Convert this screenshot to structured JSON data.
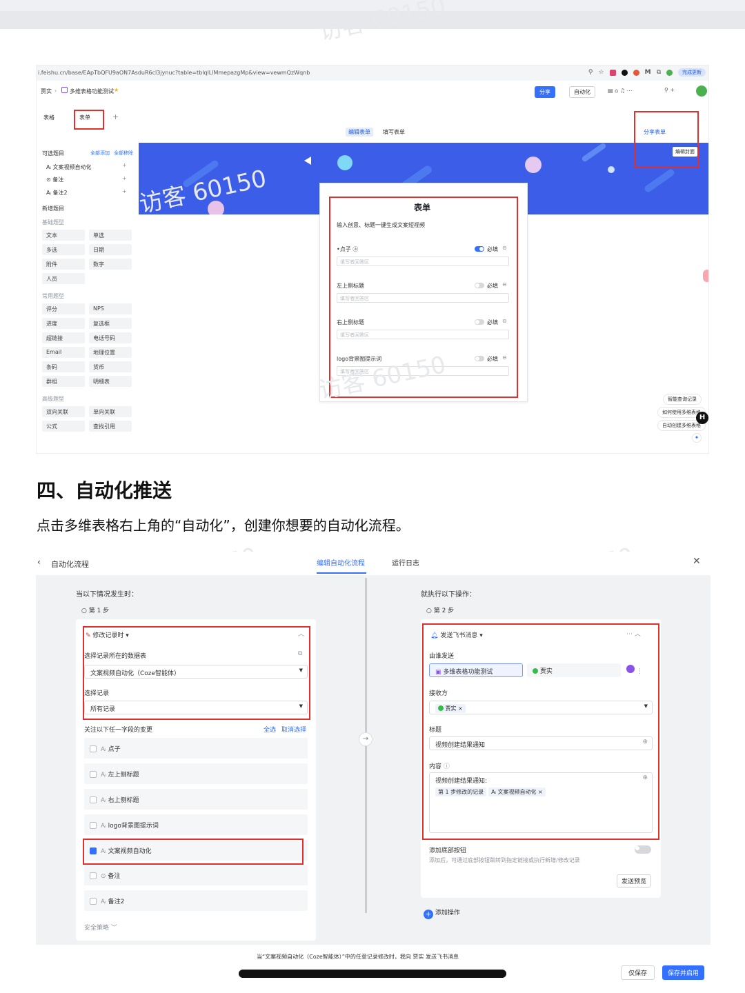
{
  "screenshot1": {
    "url": "i.feishu.cn/base/EApTbQFU9aON7AsduR6cl3jynuc?table=tblqlLlMmepazgMp&view=vewmQzWqnb",
    "update_button": "完成更新",
    "breadcrumb": [
      "贾实",
      "多维表格功能测试"
    ],
    "share_button": "分享",
    "automation_button": "自动化",
    "tabs": [
      "表格",
      "表单"
    ],
    "view_tabs": [
      "编辑表单",
      "填写表单"
    ],
    "share_form_button": "分享表单",
    "edit_cover_button": "编辑封面",
    "left_panel": {
      "selectable_title": "可选题目",
      "add_all": "全部添加",
      "remove_all": "全部移除",
      "selectable_items": [
        "文案视频自动化",
        "备注",
        "备注2"
      ],
      "new_title": "新增题目",
      "basic_title": "基础题型",
      "basic_types": [
        "文本",
        "单选",
        "多选",
        "日期",
        "附件",
        "数字",
        "人员"
      ],
      "common_title": "常用题型",
      "common_types": [
        "评分",
        "NPS",
        "进度",
        "复选框",
        "超链接",
        "电话号码",
        "Email",
        "地理位置",
        "条码",
        "货币",
        "群组",
        "明细表"
      ],
      "advanced_title": "高级题型",
      "advanced_types": [
        "双向关联",
        "单向关联",
        "公式",
        "查找引用"
      ]
    },
    "form": {
      "title": "表单",
      "description": "输入创意、标题一键生成文案短视频",
      "required_label": "必填",
      "placeholder": "填写者回答区",
      "fields": [
        "点子",
        "左上侧标题",
        "右上侧标题",
        "logo背景图提示词"
      ]
    },
    "floating_items": [
      "智能查询记录",
      "如何使用多维表格",
      "自动创建多维表格"
    ]
  },
  "heading": "四、自动化推送",
  "paragraph": "点击多维表格右上角的“自动化”，创建你想要的自动化流程。",
  "screenshot2": {
    "back_title": "自动化流程",
    "tabs": [
      "编辑自动化流程",
      "运行日志"
    ],
    "left": {
      "when_title": "当以下情况发生时：",
      "step": "第 1 步",
      "trigger": "修改记录时",
      "table_label": "选择记录所在的数据表",
      "table_value": "文案视频自动化（Coze智能体）",
      "record_label": "选择记录",
      "record_value": "所有记录",
      "watch_label": "关注以下任一字段的变更",
      "select_all": "全选",
      "deselect_all": "取消选择",
      "fields": [
        {
          "label": "点子",
          "checked": false
        },
        {
          "label": "左上侧标题",
          "checked": false
        },
        {
          "label": "右上侧标题",
          "checked": false
        },
        {
          "label": "logo背景图提示词",
          "checked": false
        },
        {
          "label": "文案视频自动化",
          "checked": true
        },
        {
          "label": "备注",
          "checked": false
        },
        {
          "label": "备注2",
          "checked": false
        }
      ],
      "security": "安全策略"
    },
    "right": {
      "then_title": "就执行以下操作：",
      "step": "第 2 步",
      "action": "发送飞书消息",
      "sender_label": "由谁发送",
      "sender_app": "多维表格功能测试",
      "sender_user": "贾实",
      "receiver_label": "接收方",
      "receiver": "贾实",
      "title_label": "标题",
      "title_value": "视频创建结果通知",
      "content_label": "内容",
      "content_value": "视频创建结果通知:",
      "content_tag1": "第 1 步修改的记录",
      "content_tag2": "文案视频自动化",
      "bottom_button_label": "添加底部按钮",
      "bottom_button_desc": "添加后，可通过底部按钮跳转到指定链接或执行新增/修改记录",
      "preview_button": "发送预览",
      "add_action": "添加操作"
    },
    "footer_summary": "当“文案视频自动化（Coze智能体）”中的任意记录修改时，我向 贾实 发送飞书消息",
    "save_button": "仅保存",
    "save_enable_button": "保存并启用"
  },
  "watermark": "访客 60150",
  "colors": {
    "accent": "#3370ff",
    "highlight": "#e0302e",
    "banner": "#3b5de7"
  }
}
